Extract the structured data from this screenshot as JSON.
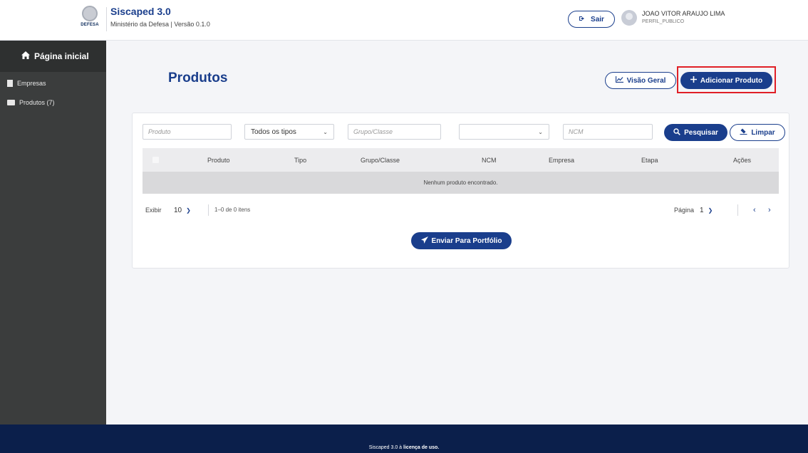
{
  "header": {
    "logo_text": "DEFESA",
    "app_title": "Siscaped 3.0",
    "app_subtitle": "Ministério da Defesa | Versão 0.1.0",
    "logout_label": "Sair",
    "logout_icon": "sign-out-icon",
    "user_name": "JOAO VITOR ARAUJO LIMA",
    "user_role": "PERFIL_PUBLICO"
  },
  "sidebar": {
    "home_label": "Página inicial",
    "items": [
      {
        "label": "Empresas",
        "icon": "building-icon"
      },
      {
        "label": "Produtos (7)",
        "icon": "folder-icon"
      }
    ]
  },
  "main": {
    "title": "Produtos",
    "overview_label": "Visão Geral",
    "add_label": "Adicionar Produto",
    "highlight_color": "#e01f26",
    "accent_color": "#1a3e8c"
  },
  "filters": {
    "produto_placeholder": "Produto",
    "tipo_selected": "Todos os tipos",
    "grupo_placeholder": "Grupo/Classe",
    "empresa_selected": "",
    "ncm_placeholder": "NCM",
    "search_label": "Pesquisar",
    "clear_label": "Limpar"
  },
  "table": {
    "columns": [
      "Produto",
      "Tipo",
      "Grupo/Classe",
      "NCM",
      "Empresa",
      "Etapa",
      "Ações"
    ],
    "rows": [],
    "empty_message": "Nenhum produto encontrado."
  },
  "pagination": {
    "show_label": "Exibir",
    "page_size": "10",
    "count_text": "1–0 de 0 itens",
    "page_label": "Página",
    "current_page": "1",
    "prev": "‹",
    "next": "›"
  },
  "actions": {
    "send_label": "Enviar Para Portfólio"
  },
  "footer": {
    "text": "Siscaped 3.0 à ",
    "link": "licença de uso."
  }
}
